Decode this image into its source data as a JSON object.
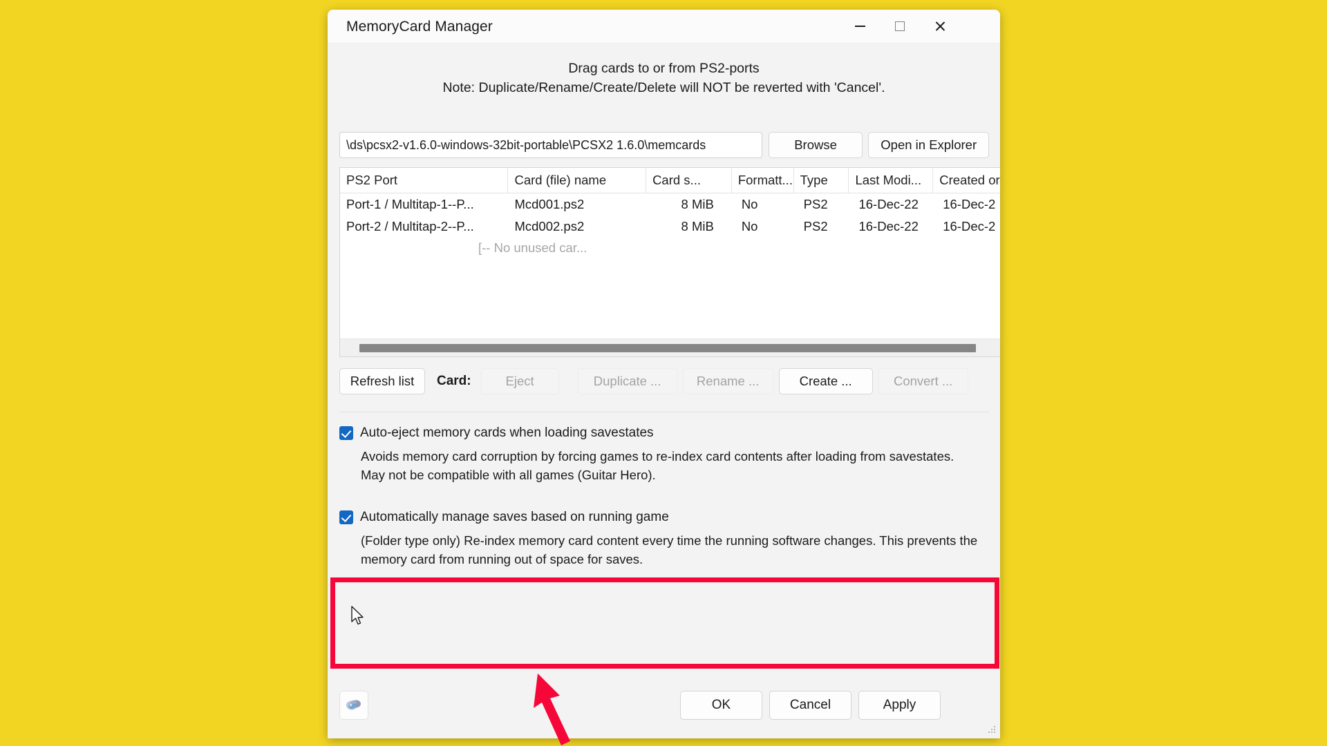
{
  "desktop": {
    "background_color": "#f2d522"
  },
  "window": {
    "title": "MemoryCard Manager",
    "controls": {
      "minimize": "minimize-icon",
      "maximize": "maximize-icon",
      "close": "close-icon"
    }
  },
  "instructions": {
    "line1": "Drag cards to or from PS2-ports",
    "line2": "Note: Duplicate/Rename/Create/Delete will NOT be reverted with 'Cancel'."
  },
  "path_row": {
    "value": "\\ds\\pcsx2-v1.6.0-windows-32bit-portable\\PCSX2 1.6.0\\memcards",
    "browse_label": "Browse",
    "open_explorer_label": "Open in Explorer"
  },
  "table": {
    "headers": [
      "PS2 Port",
      "Card (file) name",
      "Card s...",
      "Formatt...",
      "Type",
      "Last Modi...",
      "Created or"
    ],
    "rows": [
      {
        "port": "Port-1 / Multitap-1--P...",
        "file": "Mcd001.ps2",
        "size": "8 MiB",
        "formatted": "No",
        "type": "PS2",
        "last_modified": "16-Dec-22",
        "created_on": "16-Dec-2"
      },
      {
        "port": "Port-2 / Multitap-2--P...",
        "file": "Mcd002.ps2",
        "size": "8 MiB",
        "formatted": "No",
        "type": "PS2",
        "last_modified": "16-Dec-22",
        "created_on": "16-Dec-2"
      }
    ],
    "empty_row_text": "[-- No unused car..."
  },
  "actions": {
    "refresh_label": "Refresh list",
    "card_label": "Card:",
    "eject_label": "Eject",
    "duplicate_label": "Duplicate ...",
    "rename_label": "Rename ...",
    "create_label": "Create ...",
    "convert_label": "Convert ..."
  },
  "options": [
    {
      "label": "Auto-eject memory cards when loading savestates",
      "checked": true,
      "description": "Avoids memory card corruption by forcing games to re-index card contents after loading from savestates.  May not be compatible with all games (Guitar Hero)."
    },
    {
      "label": "Automatically manage saves based on running game",
      "checked": true,
      "description": "(Folder type only) Re-index memory card content every time the running software changes. This prevents the memory card from running out of space for saves."
    }
  ],
  "footer": {
    "app_icon": "pcsx2-logo-icon",
    "ok_label": "OK",
    "cancel_label": "Cancel",
    "apply_label": "Apply"
  },
  "annotations": {
    "highlight_color": "#f5073a",
    "arrow_color": "#f5073a"
  }
}
